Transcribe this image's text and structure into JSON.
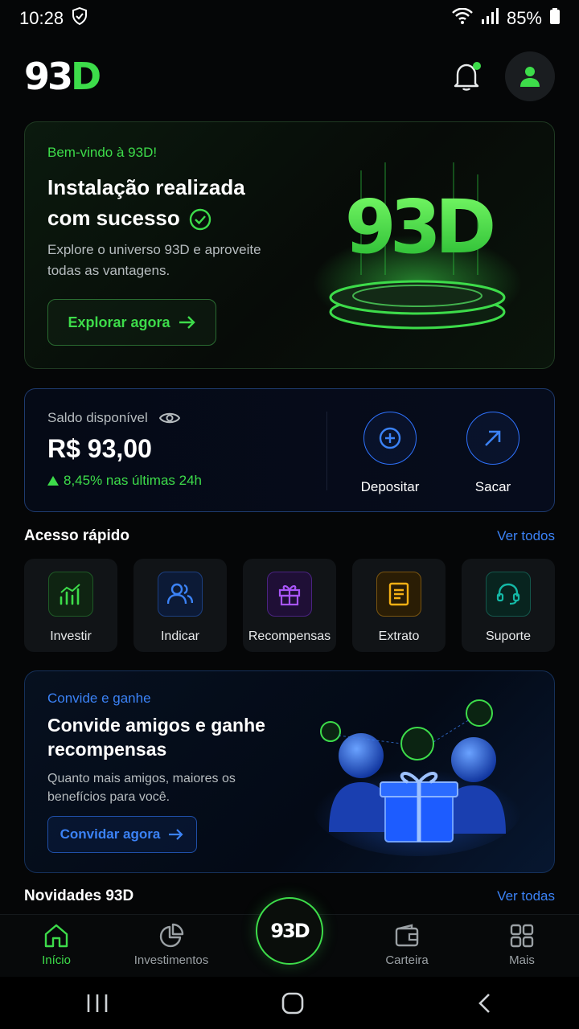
{
  "status": {
    "time": "10:28",
    "battery": "85%"
  },
  "header": {
    "logo_white": "93",
    "logo_green": "D"
  },
  "hero": {
    "eyebrow": "Bem-vindo à 93D!",
    "title": "Instalação realizada com sucesso",
    "desc": "Explore o universo 93D e aproveite todas as vantagens.",
    "button": "Explorar agora",
    "art_text": "93D"
  },
  "balance": {
    "label": "Saldo disponível",
    "amount": "R$ 93,00",
    "change": "8,45% nas últimas 24h",
    "deposit": "Depositar",
    "withdraw": "Sacar"
  },
  "quick": {
    "title": "Acesso rápido",
    "link": "Ver todos",
    "items": [
      {
        "label": "Investir",
        "icon": "chart-bars-icon",
        "color": "#3ddc4a"
      },
      {
        "label": "Indicar",
        "icon": "users-icon",
        "color": "#3b82f6"
      },
      {
        "label": "Recompensas",
        "icon": "gift-icon",
        "color": "#a855f7"
      },
      {
        "label": "Extrato",
        "icon": "document-icon",
        "color": "#f5b014"
      },
      {
        "label": "Suporte",
        "icon": "headset-icon",
        "color": "#14b8a6"
      }
    ]
  },
  "invite": {
    "eyebrow": "Convide e ganhe",
    "title": "Convide amigos e ganhe recompensas",
    "desc": "Quanto mais amigos, maiores os benefícios para você.",
    "button": "Convidar agora"
  },
  "news": {
    "title": "Novidades 93D",
    "link": "Ver todas"
  },
  "nav": {
    "items": [
      "Início",
      "Investimentos",
      "Carteira",
      "Mais"
    ],
    "center": "93D"
  },
  "colors": {
    "green": "#3ddc4a",
    "blue": "#3b82f6"
  }
}
